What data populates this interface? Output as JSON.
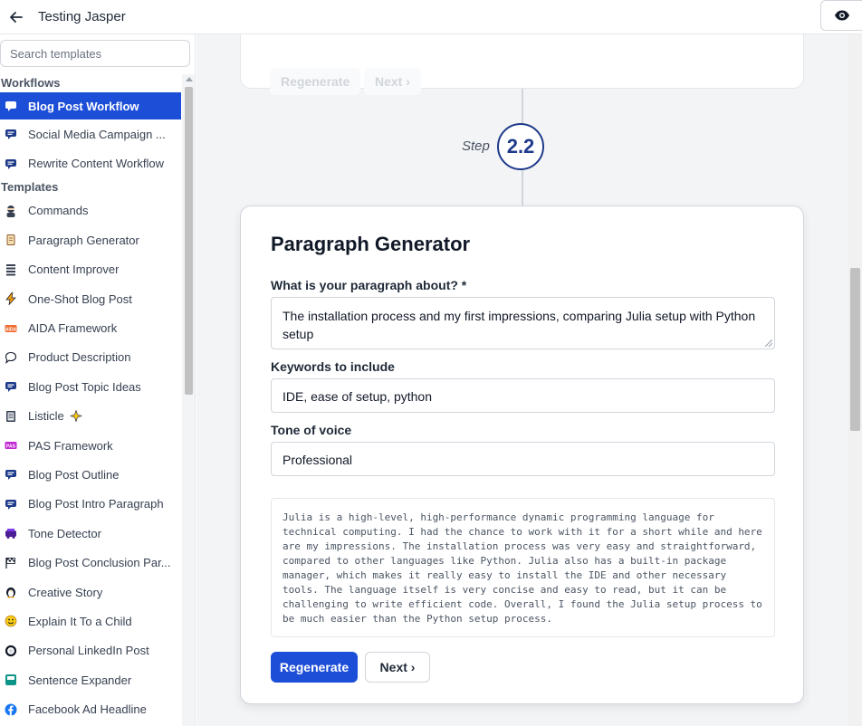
{
  "header": {
    "title": "Testing Jasper"
  },
  "sidebar": {
    "search_placeholder": "Search templates",
    "workflows_heading": "Workflows",
    "templates_heading": "Templates",
    "workflows": [
      {
        "label": "Blog Post Workflow",
        "icon": "chat-icon",
        "active": true
      },
      {
        "label": "Social Media Campaign ...",
        "icon": "chat-icon"
      },
      {
        "label": "Rewrite Content Workflow",
        "icon": "chat-icon"
      }
    ],
    "templates": [
      {
        "label": "Commands",
        "icon": "ninja-icon"
      },
      {
        "label": "Paragraph Generator",
        "icon": "scroll-icon"
      },
      {
        "label": "Content Improver",
        "icon": "lines-icon"
      },
      {
        "label": "One-Shot Blog Post",
        "icon": "lightning-icon"
      },
      {
        "label": "AIDA Framework",
        "icon": "aida-icon"
      },
      {
        "label": "Product Description",
        "icon": "speech-bubble-icon"
      },
      {
        "label": "Blog Post Topic Ideas",
        "icon": "chat-icon"
      },
      {
        "label": "Listicle",
        "icon": "list-icon",
        "badge": "sparkle-icon"
      },
      {
        "label": "PAS Framework",
        "icon": "pas-icon"
      },
      {
        "label": "Blog Post Outline",
        "icon": "chat-icon"
      },
      {
        "label": "Blog Post Intro Paragraph",
        "icon": "chat-icon"
      },
      {
        "label": "Tone Detector",
        "icon": "tone-icon"
      },
      {
        "label": "Blog Post Conclusion Par...",
        "icon": "flag-icon"
      },
      {
        "label": "Creative Story",
        "icon": "penguin-icon"
      },
      {
        "label": "Explain It To a Child",
        "icon": "smiley-icon"
      },
      {
        "label": "Personal LinkedIn Post",
        "icon": "ring-icon"
      },
      {
        "label": "Sentence Expander",
        "icon": "square-icon"
      },
      {
        "label": "Facebook Ad Headline",
        "icon": "facebook-icon"
      }
    ]
  },
  "previous_step": {
    "regenerate_label": "Regenerate",
    "next_label": "Next ›"
  },
  "step": {
    "label": "Step",
    "number": "2.2"
  },
  "card": {
    "title": "Paragraph Generator",
    "fields": [
      {
        "label": "What is your paragraph about? *",
        "value": "The installation process and my first impressions, comparing Julia setup with Python setup"
      },
      {
        "label": "Keywords to include",
        "value": "IDE, ease of setup, python"
      },
      {
        "label": "Tone of voice",
        "value": "Professional"
      }
    ],
    "output": "Julia is a high-level, high-performance dynamic programming language for technical computing. I had the chance to work with it for a short while and here are my impressions. The installation process was very easy and straightforward, compared to other languages like Python. Julia also has a built-in package manager, which makes it really easy to install the IDE and other necessary tools. The language itself is very concise and easy to read, but it can be challenging to write efficient code. Overall, I found the Julia setup process to be much easier than the Python setup process.",
    "regenerate_label": "Regenerate",
    "next_label": "Next ›"
  },
  "colors": {
    "accent": "#1d4ed8",
    "step_ring": "#1e3a8a"
  }
}
